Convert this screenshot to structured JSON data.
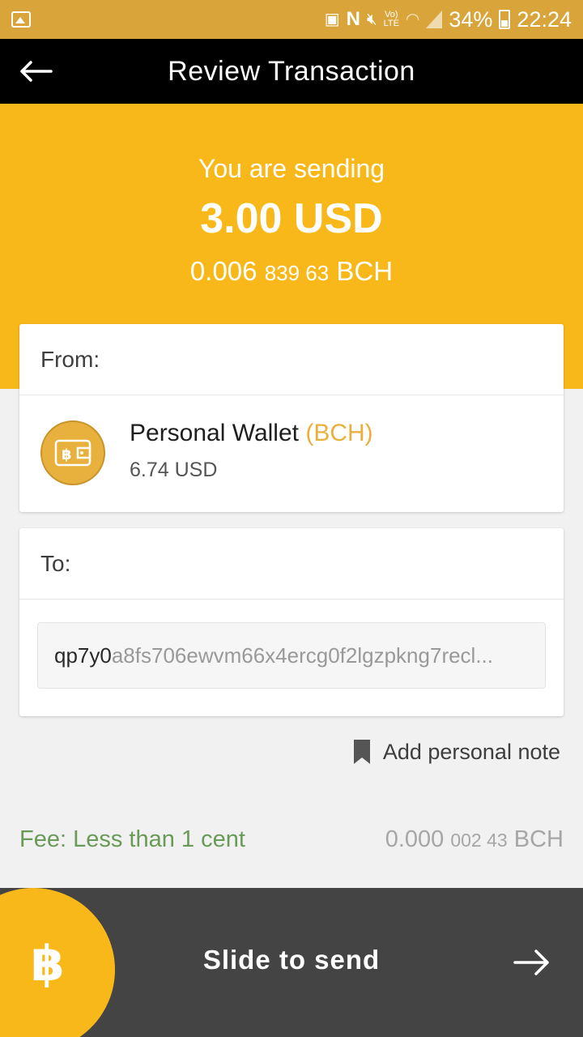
{
  "status_bar": {
    "battery": "34%",
    "time": "22:24",
    "volte_label_top": "Vo)",
    "volte_label_bottom": "LTE"
  },
  "app_bar": {
    "title": "Review Transaction"
  },
  "hero": {
    "label": "You are sending",
    "amount": "3.00 USD",
    "crypto_main": "0.006",
    "crypto_small": "839 63",
    "crypto_unit": "BCH"
  },
  "from_card": {
    "header": "From:",
    "wallet_name": "Personal Wallet",
    "wallet_currency": "(BCH)",
    "wallet_balance": "6.74 USD"
  },
  "to_card": {
    "header": "To:",
    "address_prefix": "qp7y0",
    "address_rest": "a8fs706ewvm66x4ercg0f2lgzpkng7recl..."
  },
  "note": {
    "label": "Add personal note"
  },
  "fee": {
    "label": "Fee: Less than 1 cent",
    "value_main": "0.000",
    "value_small": "002 43",
    "value_unit": "BCH"
  },
  "slider": {
    "label": "Slide to send"
  },
  "colors": {
    "accent": "#f8b819",
    "status_bar": "#d9a53a",
    "app_bar": "#000000",
    "fee_green": "#6a9a57",
    "slider_bg": "#444444"
  }
}
